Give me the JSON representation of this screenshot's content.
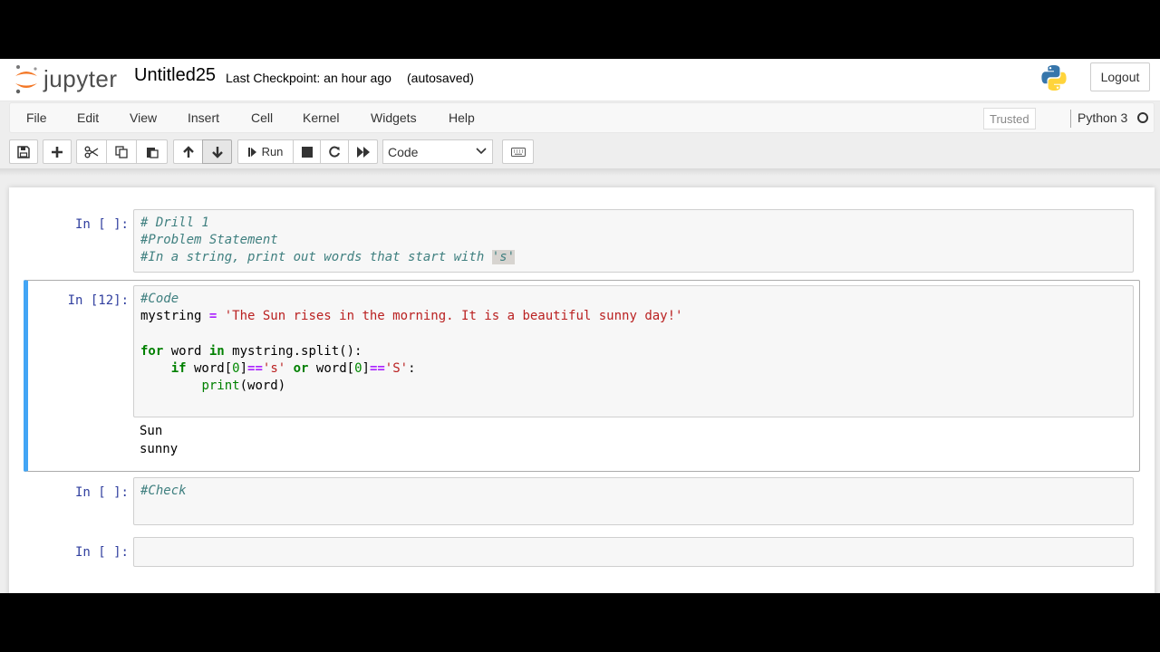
{
  "header": {
    "logo_text": "jupyter",
    "notebook_title": "Untitled25",
    "checkpoint": "Last Checkpoint: an hour ago",
    "autosave": "(autosaved)",
    "logout_label": "Logout"
  },
  "menubar": {
    "items": [
      "File",
      "Edit",
      "View",
      "Insert",
      "Cell",
      "Kernel",
      "Widgets",
      "Help"
    ],
    "trusted_label": "Trusted",
    "kernel_name": "Python 3"
  },
  "toolbar": {
    "run_label": "Run",
    "cell_type": "Code",
    "icons": [
      "save-icon",
      "plus-icon",
      "cut-icon",
      "copy-icon",
      "paste-icon",
      "arrow-up-icon",
      "arrow-down-icon",
      "step-forward-icon",
      "stop-icon",
      "restart-icon",
      "fast-forward-icon",
      "keyboard-icon"
    ]
  },
  "cells": [
    {
      "prompt": "In [ ]:",
      "lines": [
        "# Drill 1",
        "#Problem Statement",
        "#In a string, print out words that start with ",
        "'s'"
      ]
    },
    {
      "prompt": "In [12]:",
      "lines": [
        "#Code",
        "mystring",
        " = ",
        "'The Sun rises in the morning. It is a beautiful sunny day!'",
        "for",
        " word ",
        "in",
        " mystring.split():",
        "    ",
        "if",
        " word[",
        "0",
        "]",
        "==",
        "'s'",
        " ",
        "or",
        " word[",
        "0",
        "]",
        "==",
        "'S'",
        ":",
        "        ",
        "print",
        "(word)"
      ],
      "output": [
        "Sun",
        "sunny"
      ]
    },
    {
      "prompt": "In [ ]:",
      "lines": [
        "#Check"
      ]
    },
    {
      "prompt": "In [ ]:",
      "lines": []
    }
  ],
  "colors": {
    "accent": "#42a5f5",
    "prompt": "#303f9f",
    "comment": "#408080",
    "keyword": "#008000",
    "string": "#ba2121",
    "operator": "#aa22ff"
  }
}
